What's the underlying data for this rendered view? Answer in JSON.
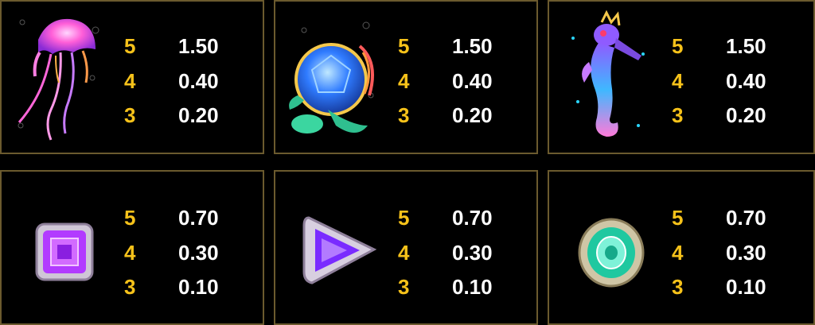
{
  "colors": {
    "count": "#f6c21a",
    "payout": "#ffffff",
    "border": "#6b5a2e",
    "background": "#000000"
  },
  "symbols": [
    {
      "icon": "jellyfish-icon",
      "pays": [
        {
          "count": "5",
          "value": "1.50"
        },
        {
          "count": "4",
          "value": "0.40"
        },
        {
          "count": "3",
          "value": "0.20"
        }
      ]
    },
    {
      "icon": "sea-turtle-icon",
      "pays": [
        {
          "count": "5",
          "value": "1.50"
        },
        {
          "count": "4",
          "value": "0.40"
        },
        {
          "count": "3",
          "value": "0.20"
        }
      ]
    },
    {
      "icon": "seahorse-icon",
      "pays": [
        {
          "count": "5",
          "value": "1.50"
        },
        {
          "count": "4",
          "value": "0.40"
        },
        {
          "count": "3",
          "value": "0.20"
        }
      ]
    },
    {
      "icon": "purple-square-gem-icon",
      "pays": [
        {
          "count": "5",
          "value": "0.70"
        },
        {
          "count": "4",
          "value": "0.30"
        },
        {
          "count": "3",
          "value": "0.10"
        }
      ]
    },
    {
      "icon": "purple-triangle-gem-icon",
      "pays": [
        {
          "count": "5",
          "value": "0.70"
        },
        {
          "count": "4",
          "value": "0.30"
        },
        {
          "count": "3",
          "value": "0.10"
        }
      ]
    },
    {
      "icon": "teal-oval-gem-icon",
      "pays": [
        {
          "count": "5",
          "value": "0.70"
        },
        {
          "count": "4",
          "value": "0.30"
        },
        {
          "count": "3",
          "value": "0.10"
        }
      ]
    }
  ]
}
